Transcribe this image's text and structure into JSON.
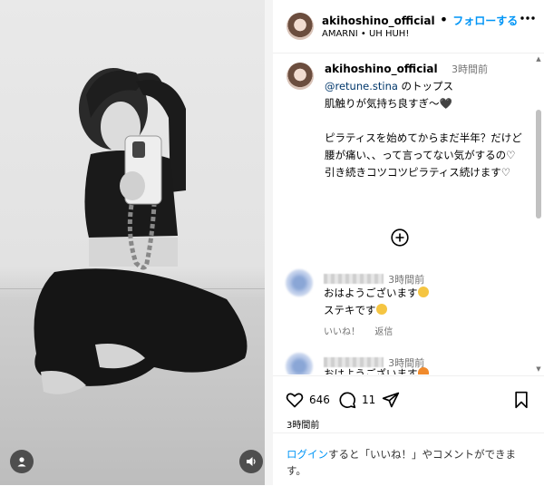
{
  "post": {
    "username": "akihoshino_official",
    "follow_label": "フォローする",
    "separator": "•",
    "audio": "AMARNI • UH HUH!",
    "caption": {
      "time": "3時間前",
      "mention": "@retune.stina",
      "line1_suffix": " のトップス",
      "line2": "肌触りが気持ち良すぎ〜🖤",
      "line3": "ピラティスを始めてからまだ半年？だけど",
      "line4": "腰が痛い、、って言ってない気がするの♡",
      "line5": "引き続きコツコツピラティス続けます♡"
    },
    "comments": [
      {
        "time": "3時間前",
        "text1": "おはようございます",
        "text2": "ステキです",
        "like_label": "いいね！",
        "reply_label": "返信"
      },
      {
        "time": "3時間前",
        "text1": "おはようございます"
      }
    ],
    "likes_count": "646",
    "comments_count": "11",
    "posted_ago": "3時間前"
  },
  "login_prompt": {
    "link": "ログイン",
    "text": "すると「いいね！」やコメントができます。"
  },
  "colors": {
    "accent": "#0095f6",
    "mention": "#00376b",
    "muted": "#737373"
  },
  "icons": [
    "more-icon",
    "heart-icon",
    "comment-icon",
    "share-icon",
    "bookmark-icon",
    "add-comment-icon",
    "user-tag-icon",
    "audio-icon"
  ]
}
